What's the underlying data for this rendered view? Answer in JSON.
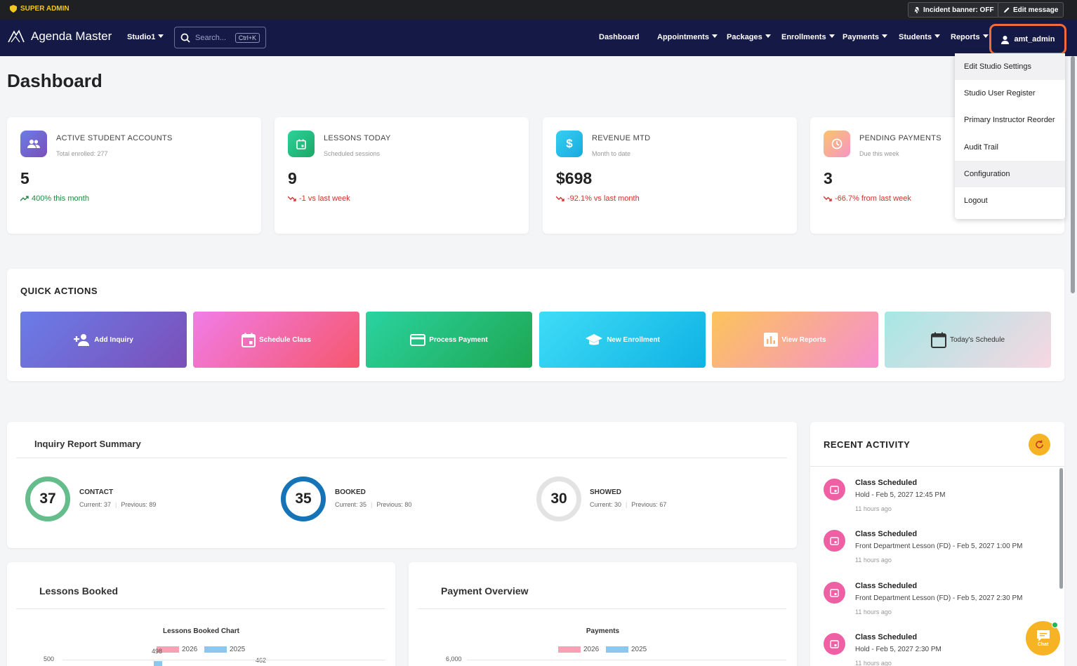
{
  "topbar": {
    "role": "SUPER ADMIN",
    "incident_banner": "Incident banner: OFF",
    "edit_message": "Edit message"
  },
  "nav": {
    "brand": "Agenda Master",
    "studio": "Studio1",
    "search_placeholder": "Search...",
    "search_shortcut": "Ctrl+K",
    "items": [
      "Dashboard",
      "Appointments",
      "Packages",
      "Enrollments",
      "Payments",
      "Students",
      "Reports"
    ],
    "user": "amt_admin"
  },
  "user_menu": [
    "Edit Studio Settings",
    "Studio User Register",
    "Primary Instructor Reorder",
    "Audit Trail",
    "Configuration",
    "Logout"
  ],
  "page_title": "Dashboard",
  "stats": [
    {
      "title": "ACTIVE STUDENT ACCOUNTS",
      "sub": "Total enrolled: 277",
      "value": "5",
      "trend": "400% this month",
      "trend_dir": "up"
    },
    {
      "title": "LESSONS TODAY",
      "sub": "Scheduled sessions",
      "value": "9",
      "trend": "-1 vs last week",
      "trend_dir": "down"
    },
    {
      "title": "REVENUE MTD",
      "sub": "Month to date",
      "value": "$698",
      "trend": "-92.1% vs last month",
      "trend_dir": "down"
    },
    {
      "title": "PENDING PAYMENTS",
      "sub": "Due this week",
      "value": "3",
      "trend": "-66.7% from last week",
      "trend_dir": "down"
    }
  ],
  "quick_actions": {
    "title": "QUICK ACTIONS",
    "buttons": [
      "Add Inquiry",
      "Schedule Class",
      "Process Payment",
      "New Enrollment",
      "View Reports",
      "Today's Schedule"
    ]
  },
  "inquiry": {
    "title": "Inquiry Report Summary",
    "items": [
      {
        "value": "37",
        "label": "CONTACT",
        "current": "Current: 37",
        "previous": "Previous: 89"
      },
      {
        "value": "35",
        "label": "BOOKED",
        "current": "Current: 35",
        "previous": "Previous: 80"
      },
      {
        "value": "30",
        "label": "SHOWED",
        "current": "Current: 30",
        "previous": "Previous: 67"
      }
    ]
  },
  "lessons_booked": {
    "title": "Lessons Booked",
    "chart_title": "Lessons Booked Chart",
    "legend": [
      "2026",
      "2025"
    ],
    "y_top": "500",
    "labels": [
      "498",
      "462"
    ]
  },
  "payment_overview": {
    "title": "Payment Overview",
    "chart_title": "Payments",
    "legend": [
      "2026",
      "2025"
    ],
    "y_top": "6,000"
  },
  "recent": {
    "title": "RECENT ACTIVITY",
    "items": [
      {
        "title": "Class Scheduled",
        "desc": "Hold - Feb 5, 2027 12:45 PM",
        "time": "11 hours ago"
      },
      {
        "title": "Class Scheduled",
        "desc": "Front Department Lesson (FD) - Feb 5, 2027 1:00 PM",
        "time": "11 hours ago"
      },
      {
        "title": "Class Scheduled",
        "desc": "Front Department Lesson (FD) - Feb 5, 2027 2:30 PM",
        "time": "11 hours ago"
      },
      {
        "title": "Class Scheduled",
        "desc": "Hold - Feb 5, 2027 2:30 PM",
        "time": "11 hours ago"
      }
    ]
  },
  "chat": {
    "label": "Chat"
  }
}
